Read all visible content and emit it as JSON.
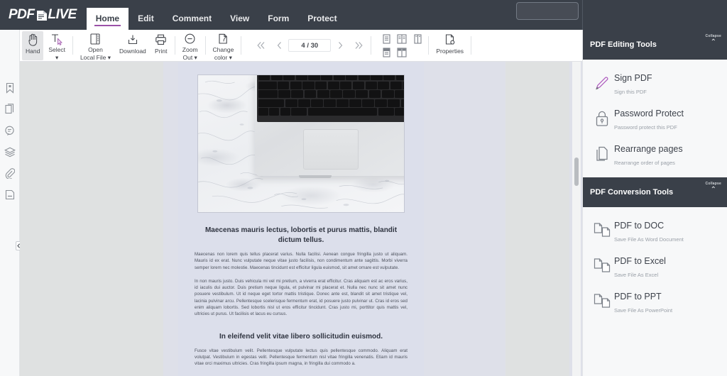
{
  "header": {
    "logo_text_left": "PDF",
    "logo_text_right": "LIVE",
    "logo_icon": "pdf-document-icon",
    "tabs": [
      {
        "label": "Home",
        "active": true
      },
      {
        "label": "Edit",
        "active": false
      },
      {
        "label": "Comment",
        "active": false
      },
      {
        "label": "View",
        "active": false
      },
      {
        "label": "Form",
        "active": false
      },
      {
        "label": "Protect",
        "active": false
      }
    ],
    "search_value": "",
    "search_placeholder": ""
  },
  "toolbar": {
    "buttons": [
      {
        "label": "Hand",
        "icon": "hand-icon",
        "active": true,
        "caret": false
      },
      {
        "label": "Select",
        "icon": "text-select-icon",
        "active": false,
        "caret": true
      },
      {
        "label": "Open\nLocal File",
        "label_line1": "Open",
        "label_line2": "Local File",
        "icon": "open-file-icon",
        "active": false,
        "caret": true
      },
      {
        "label": "Download",
        "label_line1": "Download",
        "label_line2": "",
        "icon": "download-icon",
        "active": false,
        "caret": false
      },
      {
        "label": "Print",
        "label_line1": "Print",
        "label_line2": "",
        "icon": "print-icon",
        "active": false,
        "caret": false
      },
      {
        "label": "Zoom Out",
        "label_line1": "Zoom",
        "label_line2": "Out",
        "icon": "zoom-out-icon",
        "active": false,
        "caret": true
      },
      {
        "label": "Change color",
        "label_line1": "Change",
        "label_line2": "color",
        "icon": "change-color-icon",
        "active": false,
        "caret": true
      }
    ],
    "pagination": {
      "first_icon": "double-chevron-left-icon",
      "prev_icon": "chevron-left-icon",
      "page_value": "4 / 30",
      "current_page": 4,
      "total_pages": 30,
      "next_icon": "chevron-right-icon",
      "last_icon": "double-chevron-right-icon"
    },
    "view_modes": [
      "single-page-view-icon",
      "two-page-view-icon",
      "book-view-icon",
      "continuous-page-view-icon",
      "continuous-facing-view-icon"
    ],
    "properties_label": "Properties",
    "properties_icon": "document-properties-icon"
  },
  "left_rail": {
    "icons": [
      "bookmark-icon",
      "page-thumbnails-icon",
      "comment-icon",
      "layers-icon",
      "attachment-icon",
      "signature-field-icon"
    ],
    "collapse_icon": "collapse-left-panel-icon"
  },
  "document": {
    "photo_alt": "laptop-on-marble-photo",
    "blocks": [
      {
        "type": "heading",
        "text": "Maecenas mauris lectus, lobortis et purus mattis, blandit dictum tellus."
      },
      {
        "type": "paragraph",
        "text": "Maecenas non lorem quis tellus placerat varius. Nulla facilisi. Aenean congue fringilla justo ut aliquam. Mauris id ex erat. Nunc vulputate neque vitae justo facilisis, non condimentum ante sagittis. Morbi viverra semper lorem nec molestie. Maecenas tincidunt est efficitur ligula euismod, sit amet ornare est vulputate."
      },
      {
        "type": "paragraph",
        "text": "In non mauris justo. Duis vehicula mi vel mi pretium, a viverra erat efficitur. Cras aliquam est ac eros varius, id iaculis dui auctor. Duis pretium neque ligula, et pulvinar mi placerat et. Nulla nec nunc sit amet nunc posuere vestibulum. Ut id neque eget tortor mattis tristique. Donec ante est, blandit sit amet tristique vel, lacinia pulvinar arcu. Pellentesque scelerisque fermentum erat, id posuere justo pulvinar ut. Cras id eros sed enim aliquam lobortis. Sed lobortis nisl ut eros efficitur tincidunt. Cras justo mi, porttitor quis mattis vel, ultricies ut purus. Ut facilisis et lacus eu cursus."
      },
      {
        "type": "heading",
        "text": "In eleifend velit vitae libero sollicitudin euismod."
      },
      {
        "type": "paragraph",
        "text": "Fusce vitae vestibulum velit. Pellentesque vulputate lectus quis pellentesque commodo. Aliquam erat volutpat. Vestibulum in egestas velit. Pellentesque fermentum nisl vitae fringilla venenatis. Etiam id mauris vitae orci maximus ultricies. Cras fringilla ipsum magna, in fringilla dui commodo a."
      }
    ]
  },
  "panels": [
    {
      "title": "PDF Editing Tools",
      "collapse_label": "Collapse",
      "collapse_icon": "chevron-up-icon",
      "items": [
        {
          "title": "Sign PDF",
          "subtitle": "Sign this PDF",
          "icon": "pen-sign-icon"
        },
        {
          "title": "Password Protect",
          "subtitle": "Password protect this PDF",
          "icon": "lock-icon"
        },
        {
          "title": "Rearrange pages",
          "subtitle": "Rearrange order of pages",
          "icon": "pages-copy-icon"
        }
      ]
    },
    {
      "title": "PDF Conversion Tools",
      "collapse_label": "Collapse",
      "collapse_icon": "chevron-up-icon",
      "items": [
        {
          "title": "PDF to DOC",
          "subtitle": "Save File As Word Document",
          "icon": "pdf-to-doc-icon"
        },
        {
          "title": "PDF to Excel",
          "subtitle": "Save File As Excel",
          "icon": "pdf-to-excel-icon"
        },
        {
          "title": "PDF to PPT",
          "subtitle": "Save File As PowerPoint",
          "icon": "pdf-to-ppt-icon"
        }
      ]
    }
  ],
  "colors": {
    "header_bg": "#3a4049",
    "accent_purple": "#9b51a8",
    "viewer_bg": "#dee0e9",
    "page_bg": "#dcdfeb",
    "panel_bg": "#f7f8f9"
  }
}
